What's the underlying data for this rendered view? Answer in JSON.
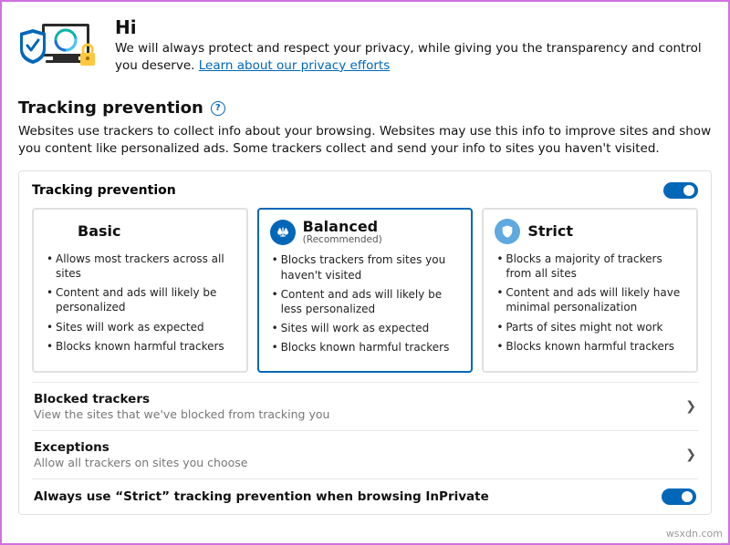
{
  "hero": {
    "greeting": "Hi",
    "body": "We will always protect and respect your privacy, while giving you the transparency and control you deserve. ",
    "link": "Learn about our privacy efforts"
  },
  "section": {
    "title": "Tracking prevention",
    "desc": "Websites use trackers to collect info about your browsing. Websites may use this info to improve sites and show you content like personalized ads. Some trackers collect and send your info to sites you haven't visited."
  },
  "panel": {
    "title": "Tracking prevention",
    "cards": {
      "basic": {
        "title": "Basic",
        "items": [
          "Allows most trackers across all sites",
          "Content and ads will likely be personalized",
          "Sites will work as expected",
          "Blocks known harmful trackers"
        ]
      },
      "balanced": {
        "title": "Balanced",
        "subtitle": "(Recommended)",
        "items": [
          "Blocks trackers from sites you haven't visited",
          "Content and ads will likely be less personalized",
          "Sites will work as expected",
          "Blocks known harmful trackers"
        ]
      },
      "strict": {
        "title": "Strict",
        "items": [
          "Blocks a majority of trackers from all sites",
          "Content and ads will likely have minimal personalization",
          "Parts of sites might not work",
          "Blocks known harmful trackers"
        ]
      }
    },
    "rows": {
      "blocked": {
        "title": "Blocked trackers",
        "sub": "View the sites that we've blocked from tracking you"
      },
      "exceptions": {
        "title": "Exceptions",
        "sub": "Allow all trackers on sites you choose"
      },
      "inprivate": {
        "title": "Always use “Strict” tracking prevention when browsing InPrivate"
      }
    }
  },
  "colors": {
    "basic": "#4aa0e6",
    "balanced": "#0067b8",
    "strict": "#5fa8e0"
  },
  "watermark": "wsxdn.com"
}
